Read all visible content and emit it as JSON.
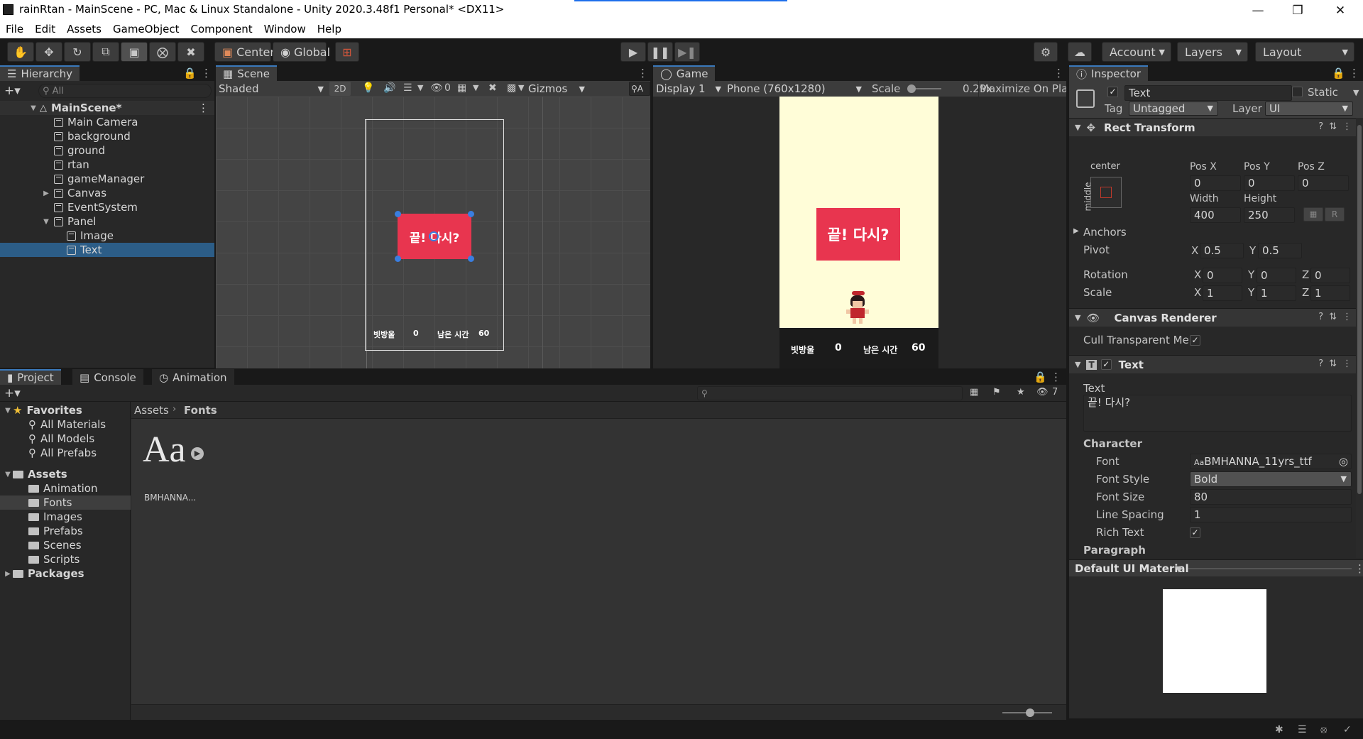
{
  "window": {
    "title": "rainRtan - MainScene - PC, Mac & Linux Standalone - Unity 2020.3.48f1 Personal* <DX11>",
    "minimize_icon": "minimize-icon",
    "maximize_icon": "restore-icon",
    "close_icon": "close-icon"
  },
  "menu": [
    "File",
    "Edit",
    "Assets",
    "GameObject",
    "Component",
    "Window",
    "Help"
  ],
  "toolbar": {
    "pivot_label": "Center",
    "space_label": "Global",
    "account_label": "Account",
    "layers_label": "Layers",
    "layout_label": "Layout"
  },
  "hierarchy": {
    "tab_label": "Hierarchy",
    "search_placeholder": "All",
    "scene_name": "MainScene*",
    "items": [
      "Main Camera",
      "background",
      "ground",
      "rtan",
      "gameManager",
      "Canvas",
      "EventSystem",
      "Panel",
      "Image",
      "Text"
    ]
  },
  "scene": {
    "tab_label": "Scene",
    "shading": "Shaded",
    "mode_2d": "2D",
    "hidden_count": "0",
    "gizmos_label": "Gizmos",
    "search_char": "A",
    "panel_text": "끝! 다시?",
    "hud_score_label": "빗방울",
    "hud_score_value": "0",
    "hud_time_label": "남은 시간",
    "hud_time_value": "60"
  },
  "game": {
    "tab_label": "Game",
    "display": "Display 1",
    "resolution": "Phone (760x1280)",
    "scale_label": "Scale",
    "scale_value": "0.29x",
    "maximize_label": "Maximize On Pla",
    "panel_text": "끝! 다시?",
    "hud_score_label": "빗방울",
    "hud_score_value": "0",
    "hud_time_label": "남은 시간",
    "hud_time_value": "60",
    "panel_color": "#e8354f",
    "background_color": "#fffdd8"
  },
  "project": {
    "tabs": [
      "Project",
      "Console",
      "Animation"
    ],
    "hidden_count": "7",
    "favorites_label": "Favorites",
    "favorites": [
      "All Materials",
      "All Models",
      "All Prefabs"
    ],
    "assets_label": "Assets",
    "asset_folders": [
      "Animation",
      "Fonts",
      "Images",
      "Prefabs",
      "Scenes",
      "Scripts"
    ],
    "packages_label": "Packages",
    "breadcrumb": [
      "Assets",
      "Fonts"
    ],
    "font_preview": "Aa",
    "asset_name": "BMHANNA..."
  },
  "inspector": {
    "tab_label": "Inspector",
    "object_name": "Text",
    "static_label": "Static",
    "tag_label": "Tag",
    "tag_value": "Untagged",
    "layer_label": "Layer",
    "layer_value": "UI",
    "rect_transform": {
      "title": "Rect Transform",
      "anchor_h": "center",
      "anchor_v": "middle",
      "pos_x_label": "Pos X",
      "pos_x": "0",
      "pos_y_label": "Pos Y",
      "pos_y": "0",
      "pos_z_label": "Pos Z",
      "pos_z": "0",
      "width_label": "Width",
      "width": "400",
      "height_label": "Height",
      "height": "250",
      "r_button": "R",
      "anchors_label": "Anchors",
      "pivot_label": "Pivot",
      "pivot_x": "0.5",
      "pivot_y": "0.5",
      "rotation_label": "Rotation",
      "rot_x": "0",
      "rot_y": "0",
      "rot_z": "0",
      "scale_label": "Scale",
      "scale_x": "1",
      "scale_y": "1",
      "scale_z": "1",
      "x": "X",
      "y": "Y",
      "z": "Z"
    },
    "canvas_renderer": {
      "title": "Canvas Renderer",
      "cull_label": "Cull Transparent Me"
    },
    "text_component": {
      "title": "Text",
      "text_label": "Text",
      "text_value": "끝! 다시?",
      "character_label": "Character",
      "font_label": "Font",
      "font_value": "BMHANNA_11yrs_ttf",
      "font_prefix": "Aa",
      "font_style_label": "Font Style",
      "font_style_value": "Bold",
      "font_size_label": "Font Size",
      "font_size_value": "80",
      "line_spacing_label": "Line Spacing",
      "line_spacing_value": "1",
      "rich_text_label": "Rich Text",
      "paragraph_label": "Paragraph"
    },
    "material_label": "Default UI Material"
  }
}
